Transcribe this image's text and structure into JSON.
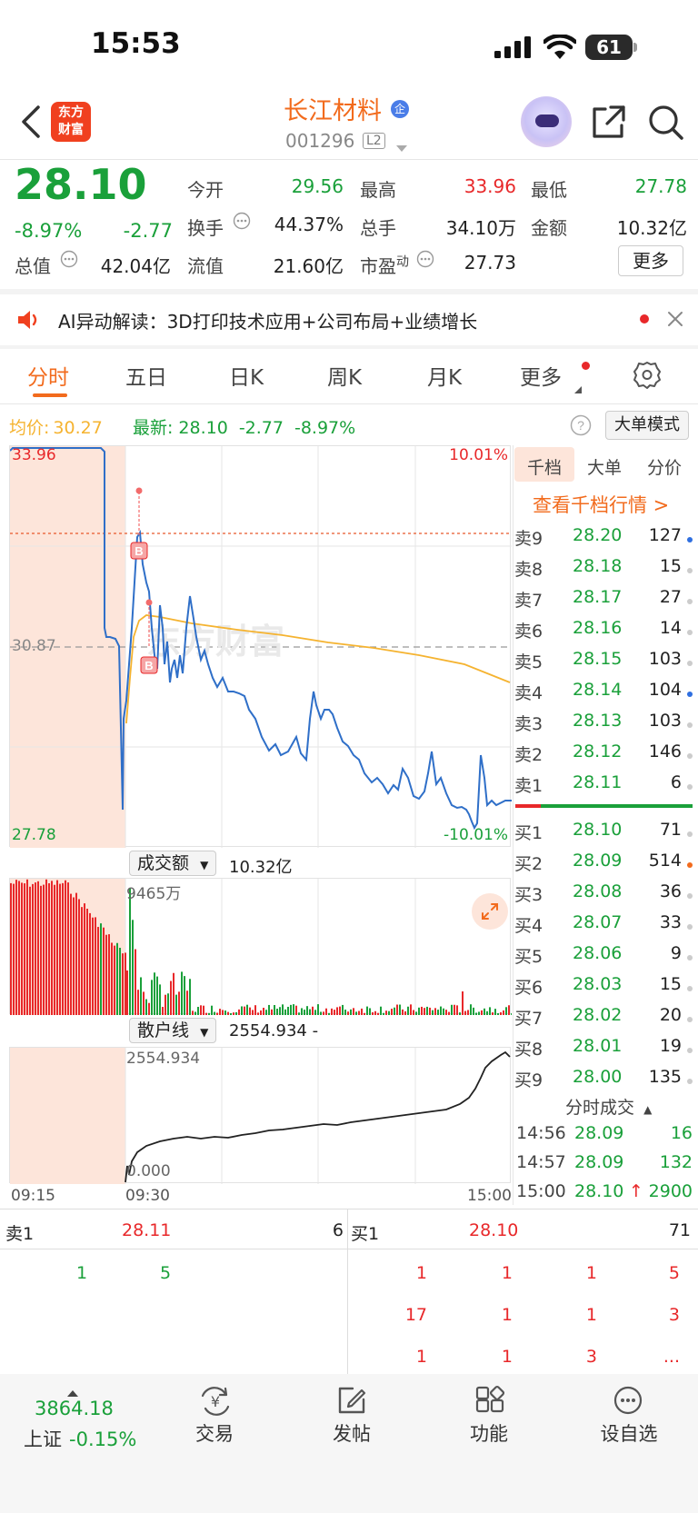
{
  "status_bar": {
    "time": "15:53",
    "battery": "61"
  },
  "header": {
    "stock_name": "长江材料",
    "badge": "企",
    "stock_code": "001296",
    "level": "L2",
    "logo_line1": "东方",
    "logo_line2": "财富"
  },
  "quote": {
    "price": "28.10",
    "change_pct": "-8.97%",
    "change": "-2.77",
    "open_label": "今开",
    "open": "29.56",
    "high_label": "最高",
    "high": "33.96",
    "low_label": "最低",
    "low": "27.78",
    "turnover_label": "换手",
    "turnover": "44.37%",
    "volume_label": "总手",
    "volume": "34.10万",
    "amount_label": "金额",
    "amount": "10.32亿",
    "mktcap_label": "总值",
    "mktcap": "42.04亿",
    "float_label": "流值",
    "float": "21.60亿",
    "pe_label": "市盈",
    "pe_sup": "动",
    "pe": "27.73",
    "more_label": "更多"
  },
  "ai_banner": {
    "text": "AI异动解读：3D打印技术应用+公司布局+业绩增长"
  },
  "tabs": [
    "分时",
    "五日",
    "日K",
    "周K",
    "月K",
    "更多"
  ],
  "info_line": {
    "avg_label": "均价:",
    "avg": "30.27",
    "latest_label": "最新:",
    "latest": "28.10",
    "change": "-2.77",
    "change_pct": "-8.97%",
    "big_mode": "大单模式"
  },
  "price_chart": {
    "top_left": "33.96",
    "top_right": "10.01%",
    "mid_left": "30.87",
    "bottom_left": "27.78",
    "bottom_right": "-10.01%",
    "watermark": "东方财富",
    "marker_b": "B"
  },
  "volume_chart": {
    "selector": "成交额",
    "total": "10.32亿",
    "max_label": "9465万"
  },
  "retail_chart": {
    "selector": "散户线",
    "value": "2554.934 -",
    "max_label": "2554.934",
    "min_label": "0.000"
  },
  "time_axis": {
    "start": "09:15",
    "open": "09:30",
    "end": "15:00"
  },
  "order_book": {
    "tabs": [
      "千档",
      "大单",
      "分价"
    ],
    "link": "查看千档行情 >",
    "asks": [
      {
        "label": "卖9",
        "price": "28.20",
        "vol": "127",
        "dot": "#2f6fe0"
      },
      {
        "label": "卖8",
        "price": "28.18",
        "vol": "15",
        "dot": "#cccccc"
      },
      {
        "label": "卖7",
        "price": "28.17",
        "vol": "27",
        "dot": "#cccccc"
      },
      {
        "label": "卖6",
        "price": "28.16",
        "vol": "14",
        "dot": "#cccccc"
      },
      {
        "label": "卖5",
        "price": "28.15",
        "vol": "103",
        "dot": "#cccccc"
      },
      {
        "label": "卖4",
        "price": "28.14",
        "vol": "104",
        "dot": "#2f6fe0"
      },
      {
        "label": "卖3",
        "price": "28.13",
        "vol": "103",
        "dot": "#cccccc"
      },
      {
        "label": "卖2",
        "price": "28.12",
        "vol": "146",
        "dot": "#cccccc"
      },
      {
        "label": "卖1",
        "price": "28.11",
        "vol": "6",
        "dot": "#cccccc"
      }
    ],
    "bids": [
      {
        "label": "买1",
        "price": "28.10",
        "vol": "71",
        "dot": "#cccccc"
      },
      {
        "label": "买2",
        "price": "28.09",
        "vol": "514",
        "dot": "#f26b1d"
      },
      {
        "label": "买3",
        "price": "28.08",
        "vol": "36",
        "dot": "#cccccc"
      },
      {
        "label": "买4",
        "price": "28.07",
        "vol": "33",
        "dot": "#cccccc"
      },
      {
        "label": "买5",
        "price": "28.06",
        "vol": "9",
        "dot": "#cccccc"
      },
      {
        "label": "买6",
        "price": "28.03",
        "vol": "15",
        "dot": "#cccccc"
      },
      {
        "label": "买7",
        "price": "28.02",
        "vol": "20",
        "dot": "#cccccc"
      },
      {
        "label": "买8",
        "price": "28.01",
        "vol": "19",
        "dot": "#cccccc"
      },
      {
        "label": "买9",
        "price": "28.00",
        "vol": "135",
        "dot": "#cccccc"
      }
    ],
    "trades_title": "分时成交",
    "trades": [
      {
        "time": "14:56",
        "price": "28.09",
        "vol": "16"
      },
      {
        "time": "14:57",
        "price": "28.09",
        "vol": "132"
      },
      {
        "time": "15:00",
        "price": "28.10",
        "arrow": "↑",
        "vol": "2900"
      }
    ]
  },
  "tape": {
    "ask1_label": "卖1",
    "ask1_price": "28.11",
    "ask1_vol": "6",
    "bid1_label": "买1",
    "bid1_price": "28.10",
    "bid1_vol": "71",
    "ask_queue": [
      "1",
      "5"
    ],
    "bid_queue": [
      [
        "1",
        "1",
        "1",
        "5"
      ],
      [
        "17",
        "1",
        "1",
        "3"
      ],
      [
        "1",
        "1",
        "3",
        "..."
      ]
    ]
  },
  "bottom_nav": {
    "index_value": "3864.18",
    "index_name": "上证",
    "index_change": "-0.15%",
    "items": [
      "交易",
      "发帖",
      "功能",
      "设自选"
    ]
  },
  "colors": {
    "up": "#e8282a",
    "down": "#1aa03a",
    "accent": "#f26b1d",
    "avg_line": "#f5b330",
    "price_line": "#2f6fc8"
  }
}
